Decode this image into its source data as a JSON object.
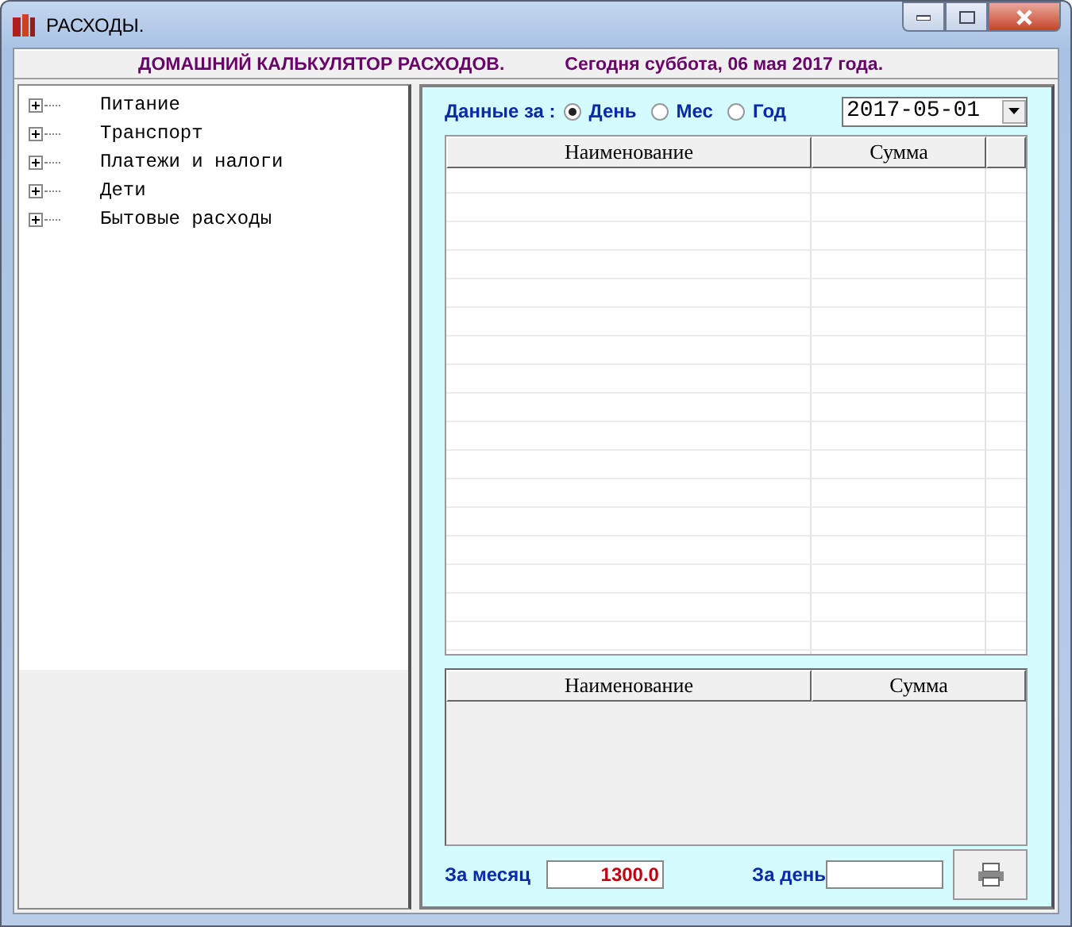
{
  "window": {
    "title": "РАСХОДЫ."
  },
  "header": {
    "title": "ДОМАШНИЙ КАЛЬКУЛЯТОР РАСХОДОВ.",
    "date_text": "Сегодня суббота, 06 мая 2017 года."
  },
  "tree": [
    {
      "label": "Питание",
      "expanded": false
    },
    {
      "label": "Транспорт",
      "expanded": false
    },
    {
      "label": "Платежи и налоги",
      "expanded": false
    },
    {
      "label": "Дети",
      "expanded": false
    },
    {
      "label": "Бытовые расходы",
      "expanded": false
    }
  ],
  "period": {
    "label": "Данные за :",
    "options": [
      {
        "label": "День",
        "selected": true
      },
      {
        "label": "Мес",
        "selected": false
      },
      {
        "label": "Год",
        "selected": false
      }
    ],
    "date": "2017-05-01"
  },
  "top_table": {
    "columns": [
      "Наименование",
      "Сумма"
    ]
  },
  "bottom_table": {
    "columns": [
      "Наименование",
      "Сумма"
    ]
  },
  "totals": {
    "month_label": "За месяц",
    "month_value": "1300.0",
    "day_label": "За день"
  }
}
